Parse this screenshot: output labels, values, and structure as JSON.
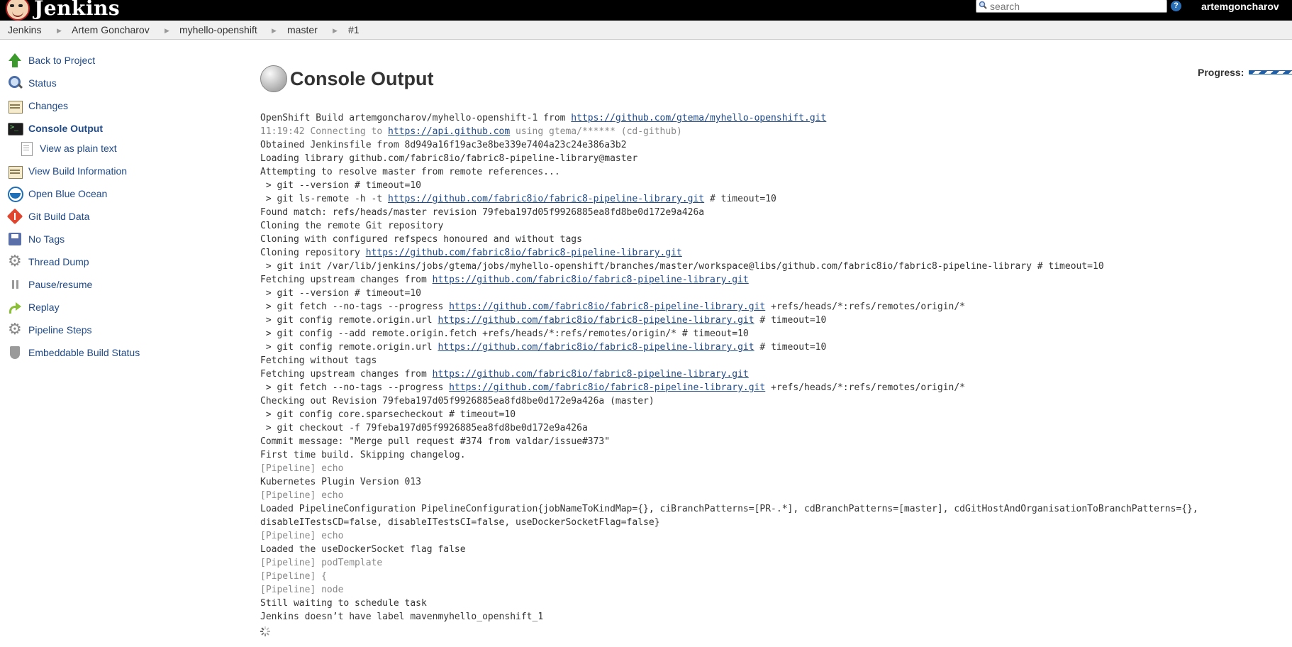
{
  "header": {
    "logo_text": "Jenkins",
    "search_placeholder": "search",
    "help_label": "?",
    "user": "artemgoncharov"
  },
  "breadcrumb": [
    "Jenkins",
    "Artem Goncharov",
    "myhello-openshift",
    "master",
    "#1"
  ],
  "sidebar": {
    "items": [
      {
        "label": "Back to Project",
        "icon": "up-arrow-icon"
      },
      {
        "label": "Status",
        "icon": "search-icon"
      },
      {
        "label": "Changes",
        "icon": "notepad-icon"
      },
      {
        "label": "Console Output",
        "icon": "terminal-icon",
        "active": true
      },
      {
        "label": "View as plain text",
        "icon": "document-icon",
        "sub": true
      },
      {
        "label": "View Build Information",
        "icon": "notepad-icon"
      },
      {
        "label": "Open Blue Ocean",
        "icon": "blue-ocean-icon"
      },
      {
        "label": "Git Build Data",
        "icon": "git-icon"
      },
      {
        "label": "No Tags",
        "icon": "save-icon"
      },
      {
        "label": "Thread Dump",
        "icon": "gear-icon"
      },
      {
        "label": "Pause/resume",
        "icon": "pause-icon"
      },
      {
        "label": "Replay",
        "icon": "replay-icon"
      },
      {
        "label": "Pipeline Steps",
        "icon": "gear-icon"
      },
      {
        "label": "Embeddable Build Status",
        "icon": "shield-icon"
      }
    ]
  },
  "main": {
    "title": "Console Output",
    "progress_label": "Progress:",
    "console": {
      "lines": [
        {
          "segments": [
            {
              "t": "OpenShift Build artemgoncharov/myhello-openshift-1 from "
            },
            {
              "t": "https://github.com/gtema/myhello-openshift.git",
              "link": true
            }
          ]
        },
        {
          "segments": [
            {
              "t": "11:19:42 Connecting to ",
              "muted": true
            },
            {
              "t": "https://api.github.com",
              "link": true
            },
            {
              "t": " using gtema/****** (cd-github)",
              "muted": true
            }
          ]
        },
        {
          "segments": [
            {
              "t": "Obtained Jenkinsfile from 8d949a16f19ac3e8be339e7404a23c24e386a3b2"
            }
          ]
        },
        {
          "segments": [
            {
              "t": "Loading library github.com/fabric8io/fabric8-pipeline-library@master"
            }
          ]
        },
        {
          "segments": [
            {
              "t": "Attempting to resolve master from remote references..."
            }
          ]
        },
        {
          "segments": [
            {
              "t": " > git --version # timeout=10"
            }
          ]
        },
        {
          "segments": [
            {
              "t": " > git ls-remote -h -t "
            },
            {
              "t": "https://github.com/fabric8io/fabric8-pipeline-library.git",
              "link": true
            },
            {
              "t": " # timeout=10"
            }
          ]
        },
        {
          "segments": [
            {
              "t": "Found match: refs/heads/master revision 79feba197d05f9926885ea8fd8be0d172e9a426a"
            }
          ]
        },
        {
          "segments": [
            {
              "t": "Cloning the remote Git repository"
            }
          ]
        },
        {
          "segments": [
            {
              "t": "Cloning with configured refspecs honoured and without tags"
            }
          ]
        },
        {
          "segments": [
            {
              "t": "Cloning repository "
            },
            {
              "t": "https://github.com/fabric8io/fabric8-pipeline-library.git",
              "link": true
            }
          ]
        },
        {
          "segments": [
            {
              "t": " > git init /var/lib/jenkins/jobs/gtema/jobs/myhello-openshift/branches/master/workspace@libs/github.com/fabric8io/fabric8-pipeline-library # timeout=10"
            }
          ]
        },
        {
          "segments": [
            {
              "t": "Fetching upstream changes from "
            },
            {
              "t": "https://github.com/fabric8io/fabric8-pipeline-library.git",
              "link": true
            }
          ]
        },
        {
          "segments": [
            {
              "t": " > git --version # timeout=10"
            }
          ]
        },
        {
          "segments": [
            {
              "t": " > git fetch --no-tags --progress "
            },
            {
              "t": "https://github.com/fabric8io/fabric8-pipeline-library.git",
              "link": true
            },
            {
              "t": " +refs/heads/*:refs/remotes/origin/*"
            }
          ]
        },
        {
          "segments": [
            {
              "t": " > git config remote.origin.url "
            },
            {
              "t": "https://github.com/fabric8io/fabric8-pipeline-library.git",
              "link": true
            },
            {
              "t": " # timeout=10"
            }
          ]
        },
        {
          "segments": [
            {
              "t": " > git config --add remote.origin.fetch +refs/heads/*:refs/remotes/origin/* # timeout=10"
            }
          ]
        },
        {
          "segments": [
            {
              "t": " > git config remote.origin.url "
            },
            {
              "t": "https://github.com/fabric8io/fabric8-pipeline-library.git",
              "link": true
            },
            {
              "t": " # timeout=10"
            }
          ]
        },
        {
          "segments": [
            {
              "t": "Fetching without tags"
            }
          ]
        },
        {
          "segments": [
            {
              "t": "Fetching upstream changes from "
            },
            {
              "t": "https://github.com/fabric8io/fabric8-pipeline-library.git",
              "link": true
            }
          ]
        },
        {
          "segments": [
            {
              "t": " > git fetch --no-tags --progress "
            },
            {
              "t": "https://github.com/fabric8io/fabric8-pipeline-library.git",
              "link": true
            },
            {
              "t": " +refs/heads/*:refs/remotes/origin/*"
            }
          ]
        },
        {
          "segments": [
            {
              "t": "Checking out Revision 79feba197d05f9926885ea8fd8be0d172e9a426a (master)"
            }
          ]
        },
        {
          "segments": [
            {
              "t": " > git config core.sparsecheckout # timeout=10"
            }
          ]
        },
        {
          "segments": [
            {
              "t": " > git checkout -f 79feba197d05f9926885ea8fd8be0d172e9a426a"
            }
          ]
        },
        {
          "segments": [
            {
              "t": "Commit message: \"Merge pull request #374 from valdar/issue#373\""
            }
          ]
        },
        {
          "segments": [
            {
              "t": "First time build. Skipping changelog."
            }
          ]
        },
        {
          "segments": [
            {
              "t": "[Pipeline] echo",
              "muted": true
            }
          ]
        },
        {
          "segments": [
            {
              "t": "Kubernetes Plugin Version 013"
            }
          ]
        },
        {
          "segments": [
            {
              "t": "[Pipeline] echo",
              "muted": true
            }
          ]
        },
        {
          "segments": [
            {
              "t": "Loaded PipelineConfiguration PipelineConfiguration{jobNameToKindMap={}, ciBranchPatterns=[PR-.*], cdBranchPatterns=[master], cdGitHostAndOrganisationToBranchPatterns={},"
            }
          ]
        },
        {
          "segments": [
            {
              "t": "disableITestsCD=false, disableITestsCI=false, useDockerSocketFlag=false}"
            }
          ]
        },
        {
          "segments": [
            {
              "t": "[Pipeline] echo",
              "muted": true
            }
          ]
        },
        {
          "segments": [
            {
              "t": "Loaded the useDockerSocket flag false"
            }
          ]
        },
        {
          "segments": [
            {
              "t": "[Pipeline] podTemplate",
              "muted": true
            }
          ]
        },
        {
          "segments": [
            {
              "t": "[Pipeline] {",
              "muted": true
            }
          ]
        },
        {
          "segments": [
            {
              "t": "[Pipeline] node",
              "muted": true
            }
          ]
        },
        {
          "segments": [
            {
              "t": "Still waiting to schedule task"
            }
          ]
        },
        {
          "segments": [
            {
              "t": "Jenkins doesn’t have label mavenmyhello_openshift_1"
            }
          ]
        }
      ]
    }
  }
}
